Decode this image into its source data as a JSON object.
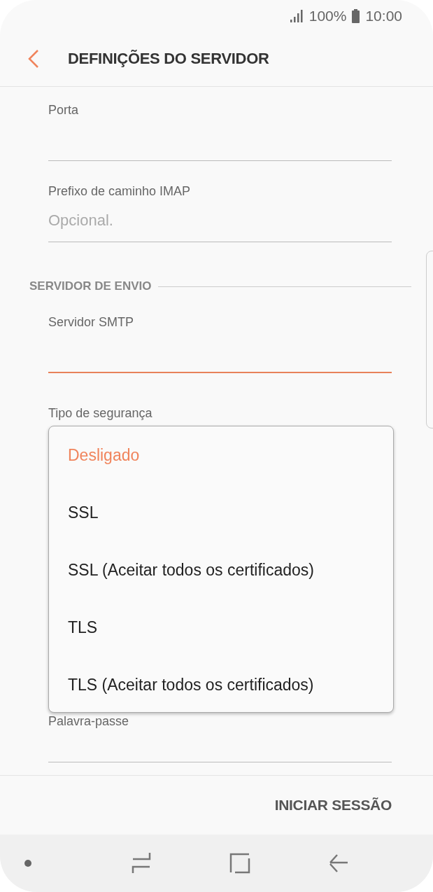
{
  "status_bar": {
    "battery": "100%",
    "time": "10:00"
  },
  "header": {
    "title": "DEFINIÇÕES DO SERVIDOR"
  },
  "incoming_fields": [
    {
      "label": "Porta",
      "focused": false
    },
    {
      "label": "Prefixo de caminho IMAP",
      "placeholder": "Opcional.",
      "focused": false
    }
  ],
  "outgoing": {
    "title": "SERVIDOR DE ENVIO",
    "fields": [
      {
        "label": "Servidor SMTP",
        "focused": true
      }
    ]
  },
  "security": {
    "label": "Tipo de segurança",
    "options": [
      {
        "label": "Desligado",
        "selected": true
      },
      {
        "label": "SSL",
        "selected": false
      },
      {
        "label": "SSL (Aceitar todos os certificados)",
        "selected": false
      },
      {
        "label": "TLS",
        "selected": false
      },
      {
        "label": "TLS (Aceitar todos os certificados)",
        "selected": false
      }
    ]
  },
  "password_field": {
    "label": "Palavra-passe",
    "focused": false
  },
  "footer": {
    "button": "INICIAR SESSÃO"
  }
}
